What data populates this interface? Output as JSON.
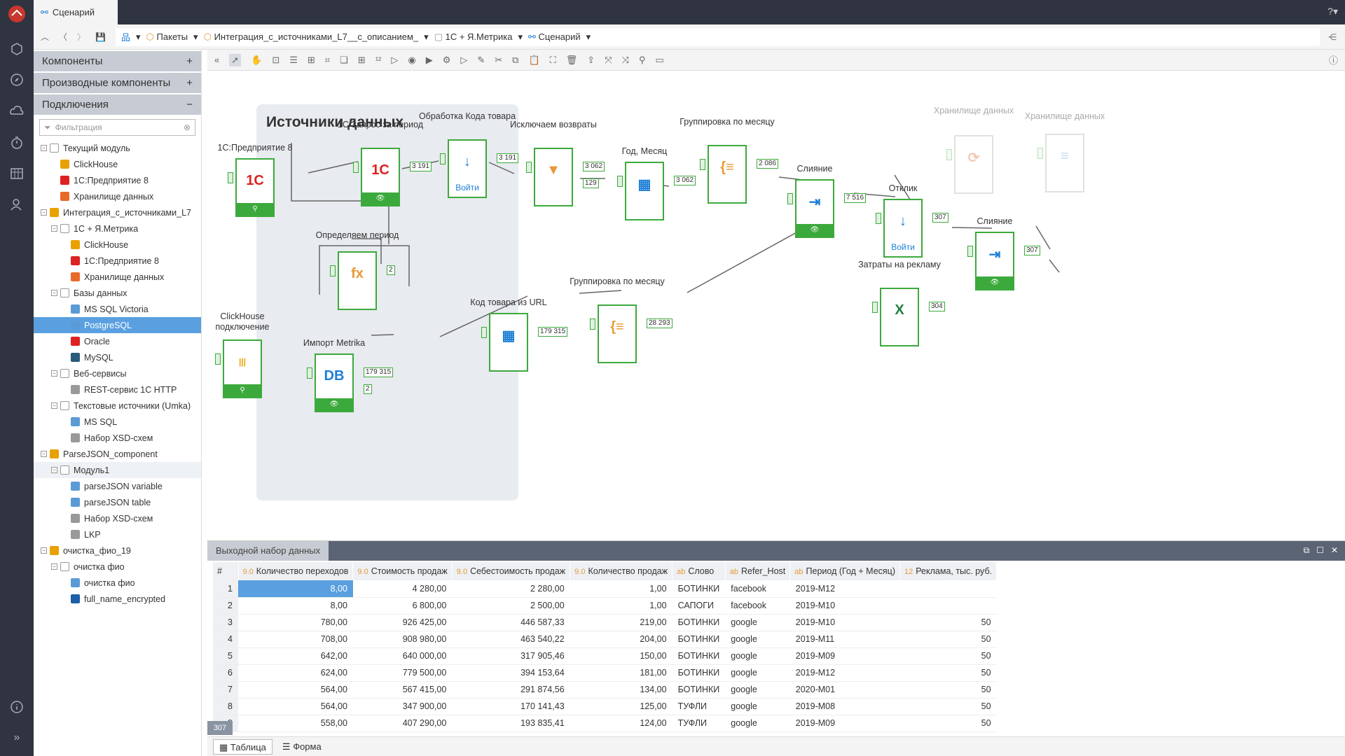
{
  "app": {
    "tab_title": "Сценарий"
  },
  "breadcrumb": [
    "Пакеты",
    "Интеграция_с_источниками_L7__с_описанием_",
    "1С + Я.Метрика",
    "Сценарий"
  ],
  "panel": {
    "sections": [
      {
        "label": "Компоненты",
        "sign": "+"
      },
      {
        "label": "Производные компоненты",
        "sign": "+"
      },
      {
        "label": "Подключения",
        "sign": "−"
      }
    ],
    "filter_placeholder": "Фильтрация",
    "tree": [
      {
        "label": "Текущий модуль",
        "level": 0,
        "icon": "module",
        "color": "#999"
      },
      {
        "label": "ClickHouse",
        "level": 1,
        "icon": "clickhouse",
        "color": "#e8a100"
      },
      {
        "label": "1С:Предприятие 8",
        "level": 1,
        "icon": "1c",
        "color": "#d22"
      },
      {
        "label": "Хранилище данных",
        "level": 1,
        "icon": "storage",
        "color": "#e86a2a"
      },
      {
        "label": "Интеграция_с_источниками_L7",
        "level": 0,
        "icon": "package",
        "color": "#e8a100"
      },
      {
        "label": "1С + Я.Метрика",
        "level": 1,
        "icon": "module",
        "color": "#999"
      },
      {
        "label": "ClickHouse",
        "level": 2,
        "icon": "clickhouse",
        "color": "#e8a100"
      },
      {
        "label": "1С:Предприятие 8",
        "level": 2,
        "icon": "1c",
        "color": "#d22"
      },
      {
        "label": "Хранилище данных",
        "level": 2,
        "icon": "storage",
        "color": "#e86a2a"
      },
      {
        "label": "Базы данных",
        "level": 1,
        "icon": "module",
        "color": "#999"
      },
      {
        "label": "MS SQL Victoria",
        "level": 2,
        "icon": "mssql",
        "color": "#5b9bd5"
      },
      {
        "label": "PostgreSQL",
        "level": 2,
        "icon": "postgres",
        "color": "#5b9bd5",
        "selected": true
      },
      {
        "label": "Oracle",
        "level": 2,
        "icon": "oracle",
        "color": "#d22"
      },
      {
        "label": "MySQL",
        "level": 2,
        "icon": "mysql",
        "color": "#2a5a7a"
      },
      {
        "label": "Веб-сервисы",
        "level": 1,
        "icon": "module",
        "color": "#999"
      },
      {
        "label": "REST-сервис 1С HTTP",
        "level": 2,
        "icon": "rest",
        "color": "#999"
      },
      {
        "label": "Текстовые источники (Umka)",
        "level": 1,
        "icon": "module",
        "color": "#999"
      },
      {
        "label": "MS SQL",
        "level": 2,
        "icon": "mssql",
        "color": "#5b9bd5"
      },
      {
        "label": "Набор XSD-схем",
        "level": 2,
        "icon": "xsd",
        "color": "#999"
      },
      {
        "label": "ParseJSON_component",
        "level": 0,
        "icon": "package",
        "color": "#e8a100"
      },
      {
        "label": "Модуль1",
        "level": 1,
        "icon": "module",
        "color": "#999",
        "hl": true
      },
      {
        "label": "parseJSON variable",
        "level": 2,
        "icon": "json",
        "color": "#5b9bd5"
      },
      {
        "label": "parseJSON table",
        "level": 2,
        "icon": "json",
        "color": "#5b9bd5"
      },
      {
        "label": "Набор XSD-схем",
        "level": 2,
        "icon": "xsd",
        "color": "#999"
      },
      {
        "label": "LKP",
        "level": 2,
        "icon": "xsd",
        "color": "#999"
      },
      {
        "label": "очистка_фио_19",
        "level": 0,
        "icon": "package",
        "color": "#e8a100"
      },
      {
        "label": "очистка фио",
        "level": 1,
        "icon": "module",
        "color": "#999"
      },
      {
        "label": "очистка фио",
        "level": 2,
        "icon": "json",
        "color": "#5b9bd5"
      },
      {
        "label": "full_name_encrypted",
        "level": 2,
        "icon": "script",
        "color": "#1d5fa8"
      }
    ]
  },
  "canvas": {
    "group_title": "Источники данных",
    "nodes": [
      {
        "id": "n1c",
        "label": "1С:Предприятие 8",
        "icon": "1С",
        "icon_color": "#d22",
        "foot": "⚲"
      },
      {
        "id": "nq",
        "label": "1С Запрос за период",
        "icon": "1С",
        "icon_color": "#d22",
        "foot": "👁",
        "badge": "3 191"
      },
      {
        "id": "nper",
        "label": "Определяем период",
        "icon": "fx",
        "icon_color": "#e89a36",
        "badge": "2"
      },
      {
        "id": "nch",
        "label": "ClickHouse подключение",
        "icon": "|||",
        "icon_color": "#e8a100",
        "foot": "⚲"
      },
      {
        "id": "nmet",
        "label": "Импорт Metrika",
        "icon": "DB",
        "icon_color": "#1d7fd6",
        "foot": "👁",
        "badge": "179 315",
        "badge2": "2"
      },
      {
        "id": "ncode",
        "label": "Обработка Кода товара",
        "icon": "↓",
        "icon_color": "#1d7fd6",
        "foot_txt": "Войти",
        "badge": "3 191"
      },
      {
        "id": "nret",
        "label": "Исключаем возвраты",
        "icon": "▼",
        "icon_color": "#e89a36",
        "badge": "3 062",
        "badge2": "129"
      },
      {
        "id": "nym",
        "label": "Год, Месяц",
        "icon": "▦",
        "icon_color": "#1d7fd6",
        "badge": "3 062"
      },
      {
        "id": "ngr1",
        "label": "Группировка по месяцу",
        "icon": "{≡",
        "icon_color": "#e89a36",
        "badge": "2 086"
      },
      {
        "id": "nmerge1",
        "label": "Слияние",
        "icon": "⇥",
        "icon_color": "#1d7fd6",
        "foot": "👁",
        "badge": "7 516"
      },
      {
        "id": "nresp",
        "label": "Отклик",
        "icon": "↓",
        "icon_color": "#1d7fd6",
        "foot_txt": "Войти",
        "badge": "307"
      },
      {
        "id": "nurl",
        "label": "Код товара из URL",
        "icon": "▦",
        "icon_color": "#1d7fd6",
        "badge": "179 315"
      },
      {
        "id": "ngr2",
        "label": "Группировка по месяцу",
        "icon": "{≡",
        "icon_color": "#e89a36",
        "badge": "28 293"
      },
      {
        "id": "nads",
        "label": "Затраты на рекламу",
        "icon": "X",
        "icon_color": "#1e7e3e",
        "badge": "304"
      },
      {
        "id": "nmerge2",
        "label": "Слияние",
        "icon": "⇥",
        "icon_color": "#1d7fd6",
        "foot": "👁",
        "badge": "307"
      },
      {
        "id": "nst1",
        "label": "Хранилище данных",
        "icon": "⟳",
        "icon_color": "#e86a2a",
        "faded": true
      },
      {
        "id": "nst2",
        "label": "Хранилище данных",
        "icon": "≡",
        "icon_color": "#5b9bd5",
        "faded": true
      }
    ]
  },
  "bottom": {
    "title": "Выходной набор данных",
    "total": "307",
    "columns": [
      {
        "label": "#",
        "type": ""
      },
      {
        "label": "Количество переходов",
        "type": "9.0"
      },
      {
        "label": "Стоимость продаж",
        "type": "9.0"
      },
      {
        "label": "Себестоимость продаж",
        "type": "9.0"
      },
      {
        "label": "Количество продаж",
        "type": "9.0"
      },
      {
        "label": "Слово",
        "type": "ab"
      },
      {
        "label": "Refer_Host",
        "type": "ab"
      },
      {
        "label": "Период (Год + Месяц)",
        "type": "ab"
      },
      {
        "label": "Реклама, тыс. руб.",
        "type": "12"
      }
    ],
    "rows": [
      [
        "1",
        "8,00",
        "4 280,00",
        "2 280,00",
        "1,00",
        "БОТИНКИ",
        "facebook",
        "2019-M12",
        ""
      ],
      [
        "2",
        "8,00",
        "6 800,00",
        "2 500,00",
        "1,00",
        "САПОГИ",
        "facebook",
        "2019-M10",
        ""
      ],
      [
        "3",
        "780,00",
        "926 425,00",
        "446 587,33",
        "219,00",
        "БОТИНКИ",
        "google",
        "2019-M10",
        "50"
      ],
      [
        "4",
        "708,00",
        "908 980,00",
        "463 540,22",
        "204,00",
        "БОТИНКИ",
        "google",
        "2019-M11",
        "50"
      ],
      [
        "5",
        "642,00",
        "640 000,00",
        "317 905,46",
        "150,00",
        "БОТИНКИ",
        "google",
        "2019-M09",
        "50"
      ],
      [
        "6",
        "624,00",
        "779 500,00",
        "394 153,64",
        "181,00",
        "БОТИНКИ",
        "google",
        "2019-M12",
        "50"
      ],
      [
        "7",
        "564,00",
        "567 415,00",
        "291 874,56",
        "134,00",
        "БОТИНКИ",
        "google",
        "2020-M01",
        "50"
      ],
      [
        "8",
        "564,00",
        "347 900,00",
        "170 141,43",
        "125,00",
        "ТУФЛИ",
        "google",
        "2019-M08",
        "50"
      ],
      [
        "9",
        "558,00",
        "407 290,00",
        "193 835,41",
        "124,00",
        "ТУФЛИ",
        "google",
        "2019-M09",
        "50"
      ]
    ],
    "tabs": [
      "Таблица",
      "Форма"
    ]
  }
}
